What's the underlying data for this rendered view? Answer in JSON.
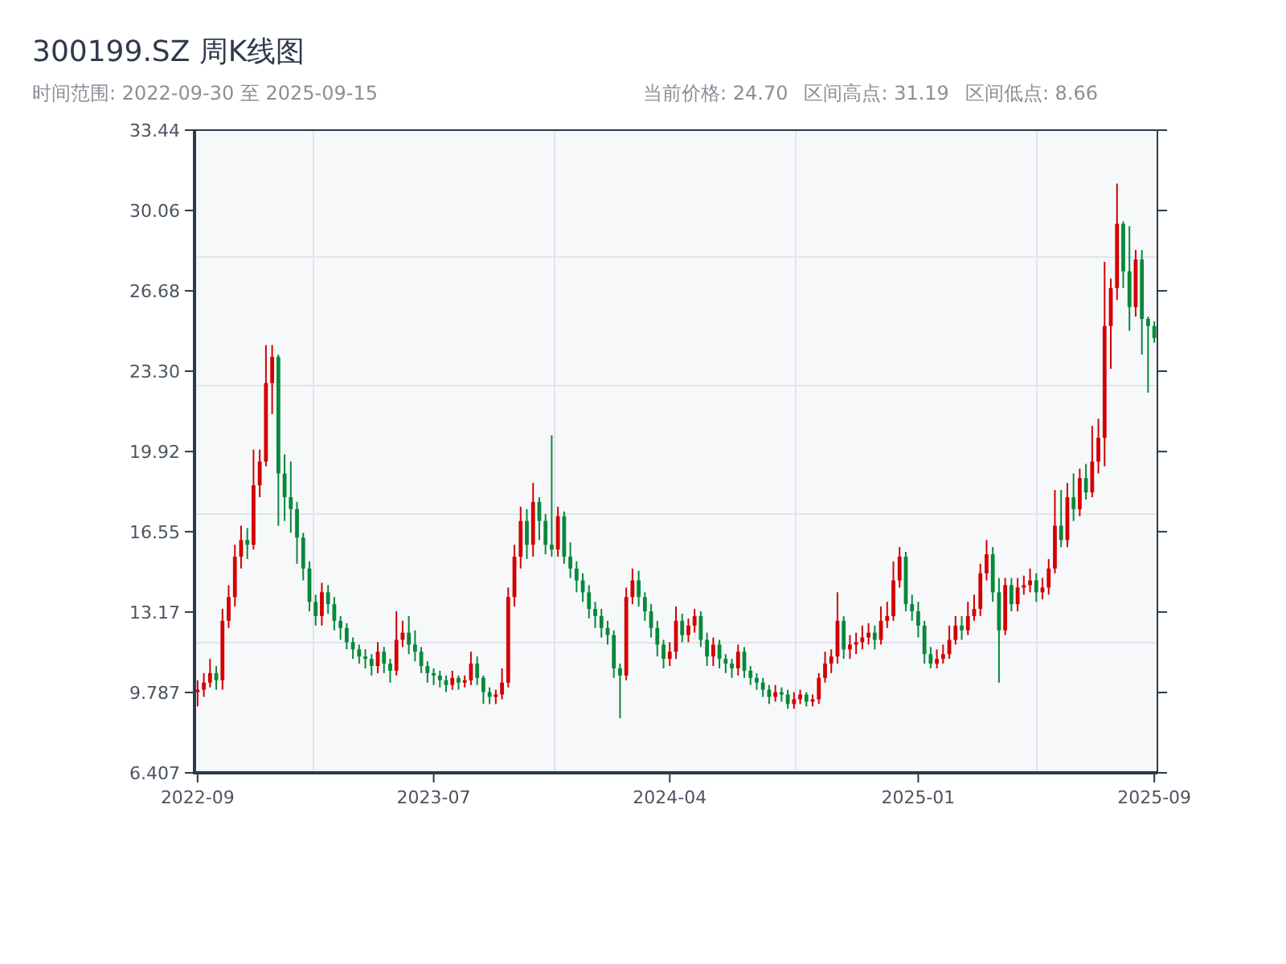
{
  "title": "300199.SZ 周K线图",
  "date_range": "时间范围: 2022-09-30 至 2025-09-15",
  "stats": [
    "当前价格: 24.70",
    "区间高点: 31.19",
    "区间低点: 8.66"
  ],
  "chart": {
    "chart_data": {
      "type": "candlestick",
      "ylim": [
        6.407,
        33.44
      ],
      "yticks": [
        {
          "value": 6.407,
          "label": "6.407"
        },
        {
          "value": 9.787,
          "label": "9.787"
        },
        {
          "value": 13.17,
          "label": "13.17"
        },
        {
          "value": 16.55,
          "label": "16.55"
        },
        {
          "value": 19.92,
          "label": "19.92"
        },
        {
          "value": 23.3,
          "label": "23.30"
        },
        {
          "value": 26.68,
          "label": "26.68"
        },
        {
          "value": 30.06,
          "label": "30.06"
        },
        {
          "value": 33.44,
          "label": "33.44"
        }
      ],
      "categories": [
        "2022-09",
        null,
        null,
        null,
        null,
        null,
        null,
        null,
        null,
        null,
        null,
        null,
        null,
        null,
        null,
        null,
        null,
        null,
        null,
        null,
        null,
        null,
        null,
        null,
        null,
        null,
        null,
        null,
        null,
        null,
        null,
        null,
        null,
        null,
        null,
        null,
        null,
        null,
        "2023-07",
        null,
        null,
        null,
        null,
        null,
        null,
        null,
        null,
        null,
        null,
        null,
        null,
        null,
        null,
        null,
        null,
        null,
        null,
        null,
        null,
        null,
        null,
        null,
        null,
        null,
        null,
        null,
        null,
        null,
        null,
        null,
        null,
        null,
        null,
        null,
        null,
        null,
        "2024-04",
        null,
        null,
        null,
        null,
        null,
        null,
        null,
        null,
        null,
        null,
        null,
        null,
        null,
        null,
        null,
        null,
        null,
        null,
        null,
        null,
        null,
        null,
        null,
        null,
        null,
        null,
        null,
        null,
        null,
        null,
        null,
        null,
        null,
        null,
        null,
        null,
        null,
        null,
        null,
        "2025-01",
        null,
        null,
        null,
        null,
        null,
        null,
        null,
        null,
        null,
        null,
        null,
        null,
        null,
        null,
        null,
        null,
        null,
        null,
        null,
        null,
        null,
        null,
        null,
        null,
        null,
        null,
        null,
        null,
        null,
        null,
        null,
        null,
        null,
        null,
        null,
        null,
        null,
        "2025-09"
      ],
      "ohlc": [
        [
          9.8,
          10.3,
          9.2,
          9.9
        ],
        [
          9.9,
          10.6,
          9.6,
          10.2
        ],
        [
          10.2,
          11.2,
          10.0,
          10.6
        ],
        [
          10.6,
          10.9,
          9.9,
          10.3
        ],
        [
          10.3,
          13.3,
          9.9,
          12.8
        ],
        [
          12.8,
          14.3,
          12.5,
          13.8
        ],
        [
          13.8,
          16.0,
          13.4,
          15.5
        ],
        [
          15.5,
          16.8,
          15.0,
          16.2
        ],
        [
          16.2,
          16.7,
          15.4,
          16.0
        ],
        [
          16.0,
          20.0,
          15.8,
          18.5
        ],
        [
          18.5,
          20.0,
          18.0,
          19.5
        ],
        [
          19.5,
          24.4,
          19.3,
          22.8
        ],
        [
          22.8,
          24.4,
          21.5,
          23.9
        ],
        [
          23.9,
          24.0,
          16.8,
          19.0
        ],
        [
          19.0,
          19.8,
          17.0,
          18.0
        ],
        [
          18.0,
          19.5,
          16.5,
          17.5
        ],
        [
          17.5,
          17.8,
          15.2,
          16.3
        ],
        [
          16.3,
          16.5,
          14.5,
          15.0
        ],
        [
          15.0,
          15.3,
          13.2,
          13.6
        ],
        [
          13.6,
          13.9,
          12.6,
          13.0
        ],
        [
          13.0,
          14.4,
          12.6,
          14.0
        ],
        [
          14.0,
          14.3,
          13.1,
          13.5
        ],
        [
          13.5,
          13.8,
          12.4,
          12.8
        ],
        [
          12.8,
          13.0,
          12.0,
          12.5
        ],
        [
          12.5,
          12.7,
          11.6,
          11.9
        ],
        [
          11.9,
          12.1,
          11.2,
          11.6
        ],
        [
          11.6,
          11.8,
          11.0,
          11.3
        ],
        [
          11.3,
          11.6,
          10.8,
          11.2
        ],
        [
          11.2,
          11.4,
          10.5,
          10.9
        ],
        [
          10.9,
          11.9,
          10.6,
          11.5
        ],
        [
          11.5,
          11.7,
          10.6,
          11.0
        ],
        [
          11.0,
          11.2,
          10.2,
          10.7
        ],
        [
          10.7,
          13.2,
          10.5,
          12.0
        ],
        [
          12.0,
          12.8,
          11.7,
          12.3
        ],
        [
          12.3,
          13.0,
          11.4,
          11.8
        ],
        [
          11.8,
          12.4,
          11.1,
          11.5
        ],
        [
          11.5,
          11.7,
          10.6,
          10.9
        ],
        [
          10.9,
          11.1,
          10.2,
          10.6
        ],
        [
          10.6,
          10.8,
          10.1,
          10.5
        ],
        [
          10.5,
          10.7,
          10.0,
          10.3
        ],
        [
          10.3,
          10.5,
          9.8,
          10.1
        ],
        [
          10.1,
          10.7,
          9.9,
          10.4
        ],
        [
          10.4,
          10.5,
          9.9,
          10.2
        ],
        [
          10.2,
          10.5,
          10.0,
          10.3
        ],
        [
          10.3,
          11.5,
          10.1,
          11.0
        ],
        [
          11.0,
          11.3,
          10.1,
          10.4
        ],
        [
          10.4,
          10.5,
          9.3,
          9.8
        ],
        [
          9.8,
          10.0,
          9.3,
          9.6
        ],
        [
          9.6,
          9.9,
          9.3,
          9.7
        ],
        [
          9.7,
          10.8,
          9.5,
          10.2
        ],
        [
          10.2,
          14.2,
          10.0,
          13.8
        ],
        [
          13.8,
          16.0,
          13.4,
          15.5
        ],
        [
          15.5,
          17.6,
          15.0,
          17.0
        ],
        [
          17.0,
          17.5,
          15.4,
          16.0
        ],
        [
          16.0,
          18.6,
          15.5,
          17.8
        ],
        [
          17.8,
          18.0,
          16.2,
          17.0
        ],
        [
          17.0,
          17.3,
          15.6,
          16.0
        ],
        [
          16.0,
          20.6,
          15.5,
          15.8
        ],
        [
          15.8,
          17.6,
          15.5,
          17.2
        ],
        [
          17.2,
          17.4,
          15.2,
          15.5
        ],
        [
          15.5,
          16.1,
          14.6,
          15.0
        ],
        [
          15.0,
          15.3,
          14.0,
          14.5
        ],
        [
          14.5,
          14.8,
          13.6,
          14.0
        ],
        [
          14.0,
          14.3,
          12.9,
          13.3
        ],
        [
          13.3,
          13.6,
          12.5,
          13.0
        ],
        [
          13.0,
          13.3,
          12.1,
          12.5
        ],
        [
          12.5,
          12.8,
          11.8,
          12.2
        ],
        [
          12.2,
          12.4,
          10.4,
          10.8
        ],
        [
          10.8,
          11.0,
          8.7,
          10.5
        ],
        [
          10.5,
          14.2,
          10.3,
          13.8
        ],
        [
          13.8,
          15.0,
          13.5,
          14.5
        ],
        [
          14.5,
          14.9,
          13.4,
          13.8
        ],
        [
          13.8,
          14.0,
          12.8,
          13.2
        ],
        [
          13.2,
          13.5,
          12.1,
          12.5
        ],
        [
          12.5,
          12.8,
          11.3,
          11.8
        ],
        [
          11.8,
          12.0,
          10.8,
          11.2
        ],
        [
          11.2,
          11.9,
          10.9,
          11.5
        ],
        [
          11.5,
          13.4,
          11.2,
          12.8
        ],
        [
          12.8,
          13.1,
          11.9,
          12.2
        ],
        [
          12.2,
          12.9,
          11.9,
          12.6
        ],
        [
          12.6,
          13.3,
          12.3,
          13.0
        ],
        [
          13.0,
          13.2,
          11.7,
          12.0
        ],
        [
          12.0,
          12.3,
          10.9,
          11.3
        ],
        [
          11.3,
          12.1,
          10.9,
          11.8
        ],
        [
          11.8,
          12.0,
          10.8,
          11.2
        ],
        [
          11.2,
          11.4,
          10.6,
          11.0
        ],
        [
          11.0,
          11.2,
          10.4,
          10.8
        ],
        [
          10.8,
          11.8,
          10.5,
          11.5
        ],
        [
          11.5,
          11.7,
          10.4,
          10.7
        ],
        [
          10.7,
          10.9,
          10.1,
          10.4
        ],
        [
          10.4,
          10.6,
          9.9,
          10.2
        ],
        [
          10.2,
          10.4,
          9.6,
          9.9
        ],
        [
          9.9,
          10.1,
          9.3,
          9.6
        ],
        [
          9.6,
          10.1,
          9.4,
          9.8
        ],
        [
          9.8,
          10.0,
          9.4,
          9.7
        ],
        [
          9.7,
          9.9,
          9.1,
          9.3
        ],
        [
          9.3,
          9.8,
          9.1,
          9.5
        ],
        [
          9.5,
          9.9,
          9.3,
          9.7
        ],
        [
          9.7,
          9.8,
          9.2,
          9.4
        ],
        [
          9.4,
          9.7,
          9.2,
          9.5
        ],
        [
          9.5,
          10.6,
          9.3,
          10.4
        ],
        [
          10.4,
          11.5,
          10.2,
          11.0
        ],
        [
          11.0,
          11.6,
          10.6,
          11.3
        ],
        [
          11.3,
          14.0,
          11.0,
          12.8
        ],
        [
          12.8,
          13.0,
          11.2,
          11.6
        ],
        [
          11.6,
          12.2,
          11.2,
          11.8
        ],
        [
          11.8,
          12.3,
          11.4,
          11.9
        ],
        [
          11.9,
          12.6,
          11.6,
          12.1
        ],
        [
          12.1,
          12.7,
          11.8,
          12.3
        ],
        [
          12.3,
          12.6,
          11.6,
          12.0
        ],
        [
          12.0,
          13.4,
          11.8,
          12.8
        ],
        [
          12.8,
          13.6,
          12.5,
          13.0
        ],
        [
          13.0,
          15.3,
          12.8,
          14.5
        ],
        [
          14.5,
          15.9,
          14.2,
          15.5
        ],
        [
          15.5,
          15.7,
          13.2,
          13.5
        ],
        [
          13.5,
          13.9,
          12.8,
          13.2
        ],
        [
          13.2,
          13.6,
          12.1,
          12.6
        ],
        [
          12.6,
          12.8,
          11.0,
          11.4
        ],
        [
          11.4,
          11.7,
          10.8,
          11.0
        ],
        [
          11.0,
          11.6,
          10.8,
          11.2
        ],
        [
          11.2,
          11.8,
          11.0,
          11.4
        ],
        [
          11.4,
          12.6,
          11.2,
          12.0
        ],
        [
          12.0,
          13.0,
          11.8,
          12.6
        ],
        [
          12.6,
          13.0,
          12.0,
          12.4
        ],
        [
          12.4,
          13.6,
          12.2,
          13.0
        ],
        [
          13.0,
          13.9,
          12.8,
          13.3
        ],
        [
          13.3,
          15.2,
          13.0,
          14.8
        ],
        [
          14.8,
          16.2,
          14.5,
          15.6
        ],
        [
          15.6,
          15.9,
          13.6,
          14.0
        ],
        [
          14.0,
          14.6,
          10.2,
          12.4
        ],
        [
          12.4,
          14.6,
          12.2,
          14.3
        ],
        [
          14.3,
          14.6,
          13.2,
          13.5
        ],
        [
          13.5,
          14.6,
          13.2,
          14.2
        ],
        [
          14.2,
          14.7,
          13.9,
          14.3
        ],
        [
          14.3,
          15.0,
          14.0,
          14.5
        ],
        [
          14.5,
          14.8,
          13.6,
          14.0
        ],
        [
          14.0,
          14.6,
          13.7,
          14.2
        ],
        [
          14.2,
          15.4,
          13.9,
          15.0
        ],
        [
          15.0,
          18.3,
          14.8,
          16.8
        ],
        [
          16.8,
          18.3,
          15.9,
          16.2
        ],
        [
          16.2,
          18.6,
          15.9,
          18.0
        ],
        [
          18.0,
          19.0,
          17.0,
          17.5
        ],
        [
          17.5,
          19.2,
          17.2,
          18.8
        ],
        [
          18.8,
          19.4,
          17.9,
          18.2
        ],
        [
          18.2,
          21.0,
          18.0,
          19.5
        ],
        [
          19.5,
          21.3,
          19.0,
          20.5
        ],
        [
          20.5,
          27.9,
          19.3,
          25.2
        ],
        [
          25.2,
          27.2,
          23.4,
          26.8
        ],
        [
          26.8,
          31.19,
          26.3,
          29.5
        ],
        [
          29.5,
          29.6,
          26.8,
          27.5
        ],
        [
          27.5,
          29.4,
          25.0,
          26.0
        ],
        [
          26.0,
          28.4,
          25.6,
          28.0
        ],
        [
          28.0,
          28.4,
          24.0,
          25.5
        ],
        [
          25.5,
          25.6,
          22.4,
          25.2
        ],
        [
          25.2,
          25.4,
          24.5,
          24.7
        ]
      ]
    }
  }
}
